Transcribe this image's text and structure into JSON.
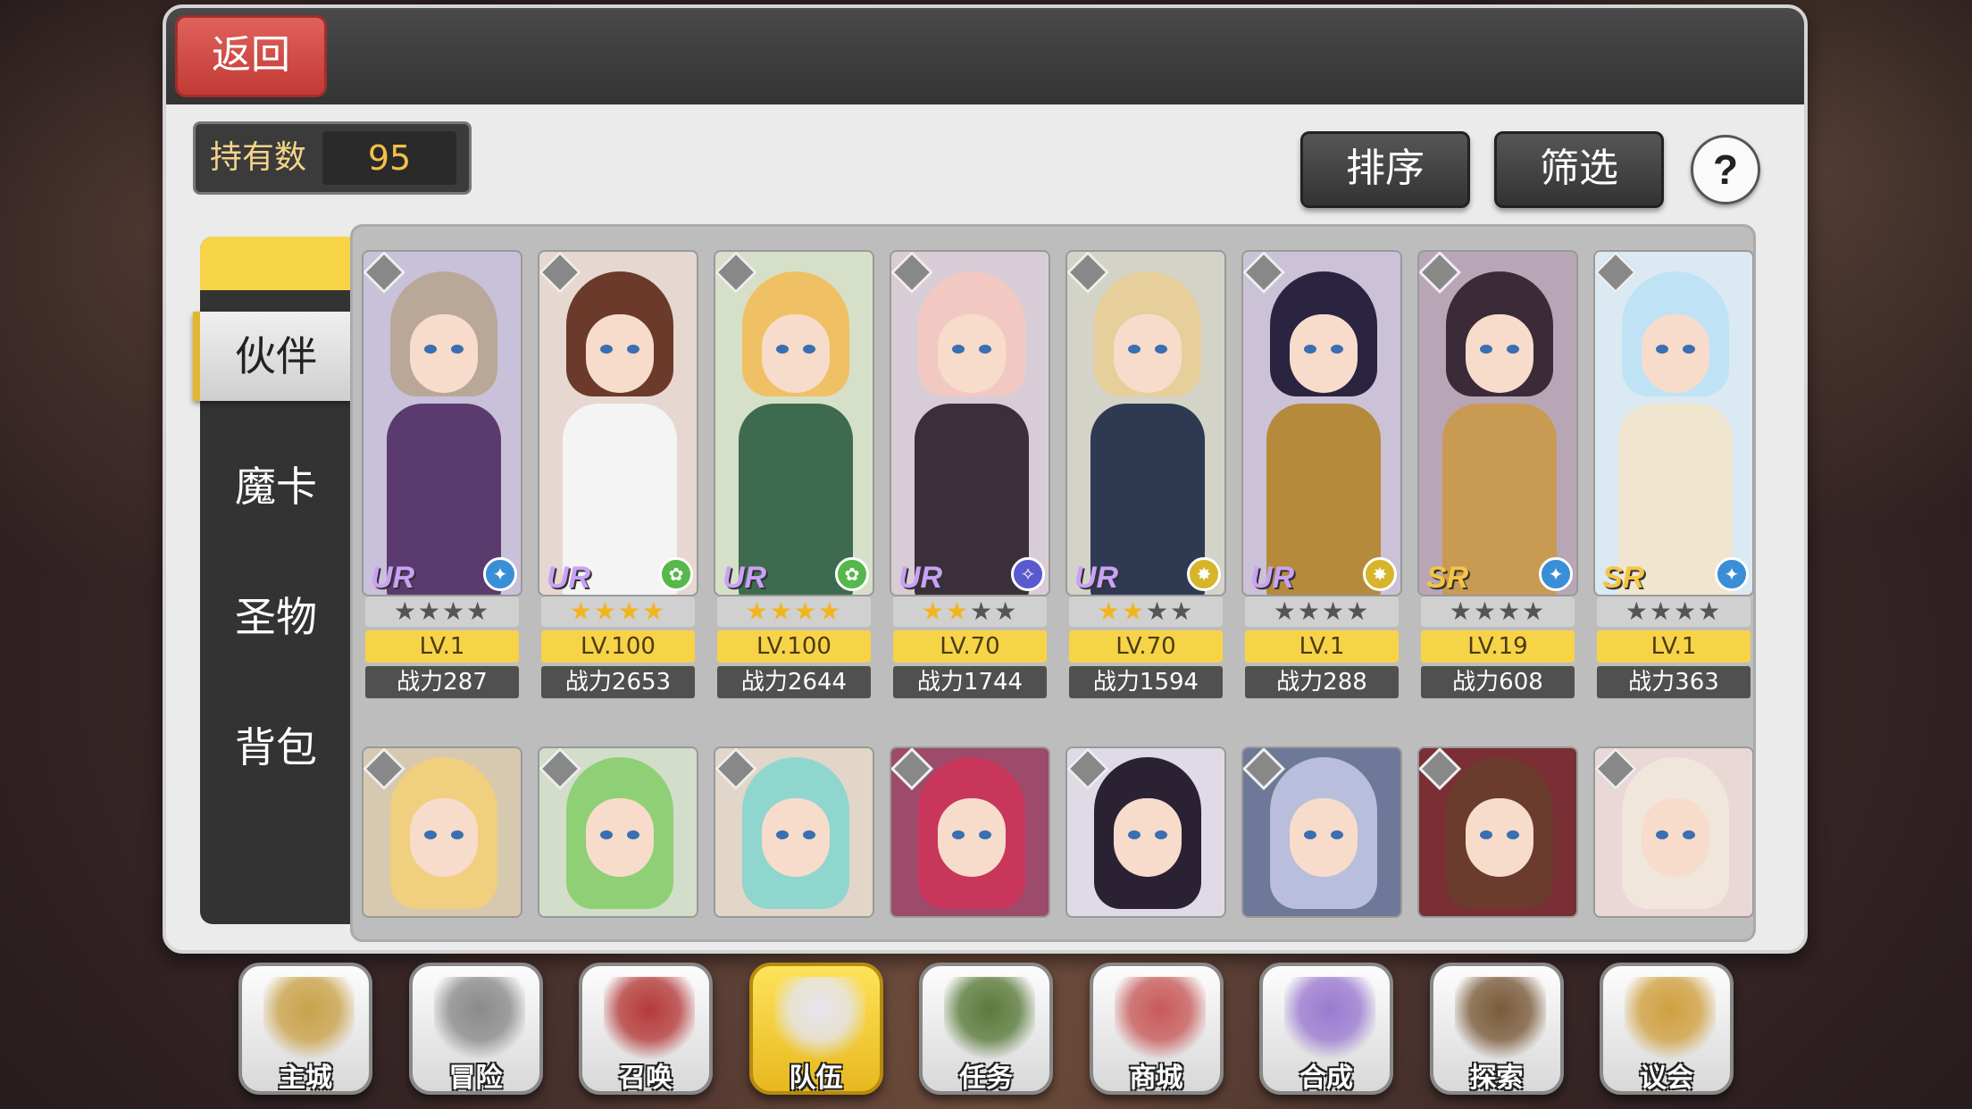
{
  "header": {
    "back_label": "返回"
  },
  "owned": {
    "label": "持有数",
    "value": "95"
  },
  "toolbar": {
    "sort_label": "排序",
    "filter_label": "筛选",
    "help_label": "?"
  },
  "tabs": [
    {
      "label": "伙伴",
      "active": true
    },
    {
      "label": "魔卡",
      "active": false
    },
    {
      "label": "圣物",
      "active": false
    },
    {
      "label": "背包",
      "active": false
    }
  ],
  "cards_row1": [
    {
      "rarity": "UR",
      "stars": 0,
      "level": "LV.1",
      "power": "战力287",
      "element": "wind"
    },
    {
      "rarity": "UR",
      "stars": 4,
      "level": "LV.100",
      "power": "战力2653",
      "element": "earth"
    },
    {
      "rarity": "UR",
      "stars": 4,
      "level": "LV.100",
      "power": "战力2644",
      "element": "earth"
    },
    {
      "rarity": "UR",
      "stars": 2,
      "level": "LV.70",
      "power": "战力1744",
      "element": "dark"
    },
    {
      "rarity": "UR",
      "stars": 2,
      "level": "LV.70",
      "power": "战力1594",
      "element": "light"
    },
    {
      "rarity": "UR",
      "stars": 0,
      "level": "LV.1",
      "power": "战力288",
      "element": "light"
    },
    {
      "rarity": "SR",
      "stars": 0,
      "level": "LV.19",
      "power": "战力608",
      "element": "wind"
    },
    {
      "rarity": "SR",
      "stars": 0,
      "level": "LV.1",
      "power": "战力363",
      "element": "wind"
    }
  ],
  "nav": [
    {
      "label": "主城",
      "active": false
    },
    {
      "label": "冒险",
      "active": false
    },
    {
      "label": "召唤",
      "active": false
    },
    {
      "label": "队伍",
      "active": true
    },
    {
      "label": "任务",
      "active": false
    },
    {
      "label": "商城",
      "active": false
    },
    {
      "label": "合成",
      "active": false
    },
    {
      "label": "探索",
      "active": false
    },
    {
      "label": "议会",
      "active": false
    }
  ],
  "colors": {
    "accent_yellow": "#f7d348",
    "back_red": "#d44a44",
    "panel_bg": "#ebebeb",
    "dark_bar": "#3b3b3b"
  }
}
